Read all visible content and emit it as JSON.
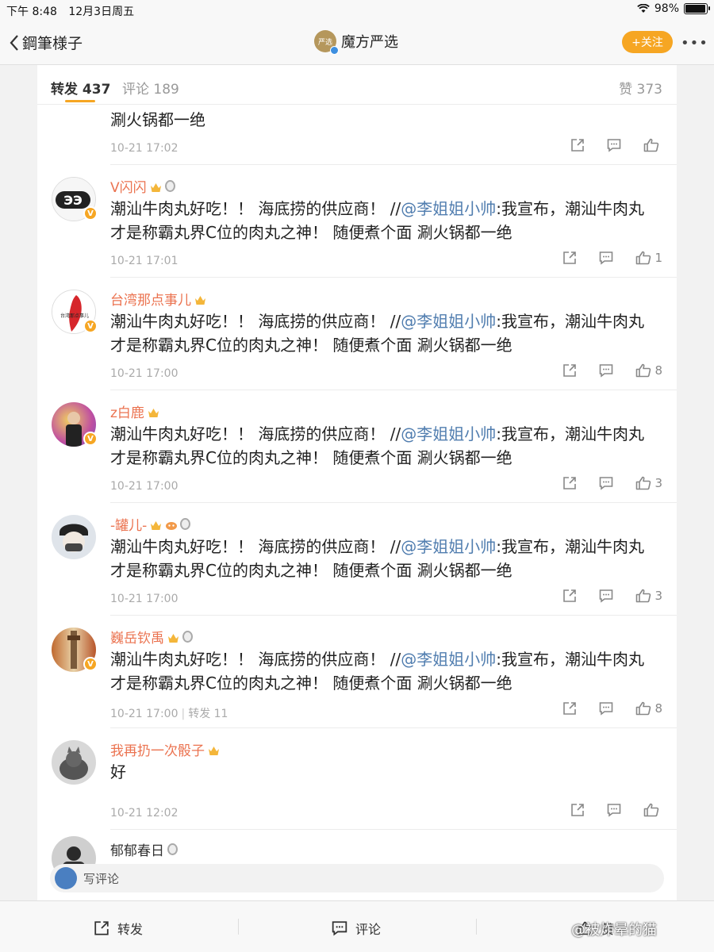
{
  "status": {
    "time": "下午 8:48",
    "date": "12月3日周五",
    "battery": "98%",
    "battery_level": 0.98
  },
  "nav": {
    "back_label": "鋼筆様子",
    "title": "魔方严选",
    "avatar_text": "严选",
    "follow_label": "+关注",
    "more": "•••"
  },
  "tabs": {
    "repost": "转发 437",
    "comment": "评论 189",
    "like": "赞 373"
  },
  "items": [
    {
      "text": "涮火锅都一绝",
      "time": "10-21 17:02",
      "like_count": ""
    },
    {
      "name": "V闪闪",
      "prefix": "潮汕牛肉丸好吃！！ 海底捞的供应商！ //",
      "mention": "@李姐姐小帅",
      "suffix": ":我宣布，潮汕牛肉丸才是称霸丸界C位的肉丸之神！ 随便煮个面 涮火锅都一绝",
      "time": "10-21 17:01",
      "like_count": "1"
    },
    {
      "name": "台湾那点事儿",
      "prefix": "潮汕牛肉丸好吃！！ 海底捞的供应商！ //",
      "mention": "@李姐姐小帅",
      "suffix": ":我宣布，潮汕牛肉丸才是称霸丸界C位的肉丸之神！ 随便煮个面 涮火锅都一绝",
      "time": "10-21 17:00",
      "like_count": "8"
    },
    {
      "name": "z白鹿",
      "prefix": "潮汕牛肉丸好吃！！ 海底捞的供应商！ //",
      "mention": "@李姐姐小帅",
      "suffix": ":我宣布，潮汕牛肉丸才是称霸丸界C位的肉丸之神！ 随便煮个面 涮火锅都一绝",
      "time": "10-21 17:00",
      "like_count": "3"
    },
    {
      "name": "-罐儿-",
      "prefix": "潮汕牛肉丸好吃！！ 海底捞的供应商！ //",
      "mention": "@李姐姐小帅",
      "suffix": ":我宣布，潮汕牛肉丸才是称霸丸界C位的肉丸之神！ 随便煮个面 涮火锅都一绝",
      "time": "10-21 17:00",
      "like_count": "3"
    },
    {
      "name": "巍岳钦禹",
      "prefix": "潮汕牛肉丸好吃！！ 海底捞的供应商！ //",
      "mention": "@李姐姐小帅",
      "suffix": ":我宣布，潮汕牛肉丸才是称霸丸界C位的肉丸之神！ 随便煮个面 涮火锅都一绝",
      "time": "10-21 17:00",
      "repost_label": "转发 11",
      "like_count": "8"
    },
    {
      "name": "我再扔一次骰子",
      "text": "好",
      "time": "10-21 12:02",
      "like_count": ""
    },
    {
      "name": "郁郁春日"
    }
  ],
  "avatar_texts": {
    "v": "ЭЭ",
    "taiwan": "台湾那点事儿"
  },
  "write_placeholder": "写评论",
  "bottom": {
    "repost": "转发",
    "comment": "评论",
    "like": "赞"
  },
  "watermark": "@被炸晕的猫",
  "colors": {
    "accent": "#f6a623",
    "username": "#eb7350",
    "mention": "#507daf"
  }
}
